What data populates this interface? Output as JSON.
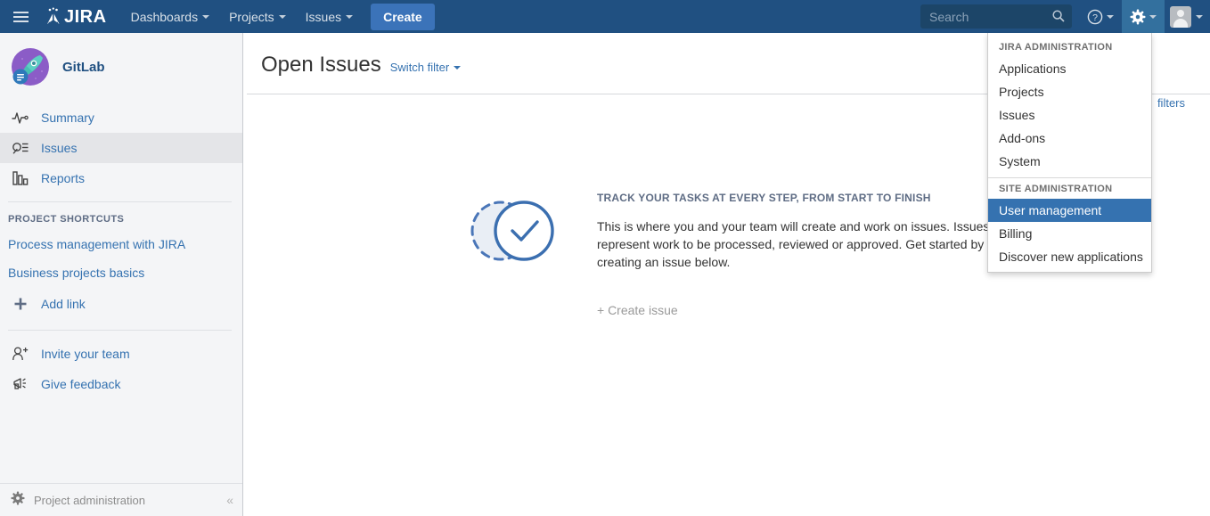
{
  "topnav": {
    "menu_icon": "hamburger-icon",
    "logo_text": "JIRA",
    "items": [
      {
        "label": "Dashboards",
        "has_caret": true
      },
      {
        "label": "Projects",
        "has_caret": true
      },
      {
        "label": "Issues",
        "has_caret": true
      }
    ],
    "create_label": "Create",
    "search_placeholder": "Search",
    "search_value": "",
    "help_icon": "question-circle-icon",
    "settings_icon": "gear-icon",
    "avatar_icon": "user-avatar-icon",
    "background_color": "#205081",
    "create_button_color": "#3b73b9",
    "active_icon_background": "#33709e"
  },
  "admin_menu": {
    "sections": [
      {
        "heading": "JIRA ADMINISTRATION",
        "items": [
          {
            "label": "Applications",
            "selected": false
          },
          {
            "label": "Projects",
            "selected": false
          },
          {
            "label": "Issues",
            "selected": false
          },
          {
            "label": "Add-ons",
            "selected": false
          },
          {
            "label": "System",
            "selected": false
          }
        ]
      },
      {
        "heading": "SITE ADMINISTRATION",
        "items": [
          {
            "label": "User management",
            "selected": true
          },
          {
            "label": "Billing",
            "selected": false
          },
          {
            "label": "Discover new applications",
            "selected": false
          }
        ]
      }
    ],
    "highlight_color": "#3572b0"
  },
  "sidebar": {
    "project_name": "GitLab",
    "project_avatar_icon": "rocket-avatar-icon",
    "project_type_badge_icon": "business-project-badge-icon",
    "nav_items": [
      {
        "label": "Summary",
        "icon": "activity-pulse-icon",
        "active": false
      },
      {
        "label": "Issues",
        "icon": "issues-search-icon",
        "active": true
      },
      {
        "label": "Reports",
        "icon": "bar-chart-icon",
        "active": false
      }
    ],
    "shortcuts_heading": "PROJECT SHORTCUTS",
    "shortcuts": [
      {
        "label": "Process management with JIRA"
      },
      {
        "label": "Business projects basics"
      }
    ],
    "add_link_label": "Add link",
    "add_link_icon": "plus-icon",
    "footer_links": [
      {
        "label": "Invite your team",
        "icon": "person-add-icon"
      },
      {
        "label": "Give feedback",
        "icon": "megaphone-icon"
      }
    ],
    "admin_label": "Project administration",
    "admin_icon": "gear-icon",
    "collapse_icon": "double-chevron-left-icon",
    "background_color": "#f4f5f7",
    "active_item_color": "#e4e5e8",
    "link_color": "#3572b0"
  },
  "main": {
    "page_title": "Open Issues",
    "switch_filter_label": "Switch filter",
    "saved_filters_label": "filters",
    "empty_state": {
      "illustration_icon": "check-circle-illustration",
      "heading": "TRACK YOUR TASKS AT EVERY STEP, FROM START TO FINISH",
      "body": "This is where you and your team will create and work on issues. Issues can represent work to be processed, reviewed or approved. Get started by creating an issue below.",
      "create_issue_label": "+ Create issue"
    }
  }
}
